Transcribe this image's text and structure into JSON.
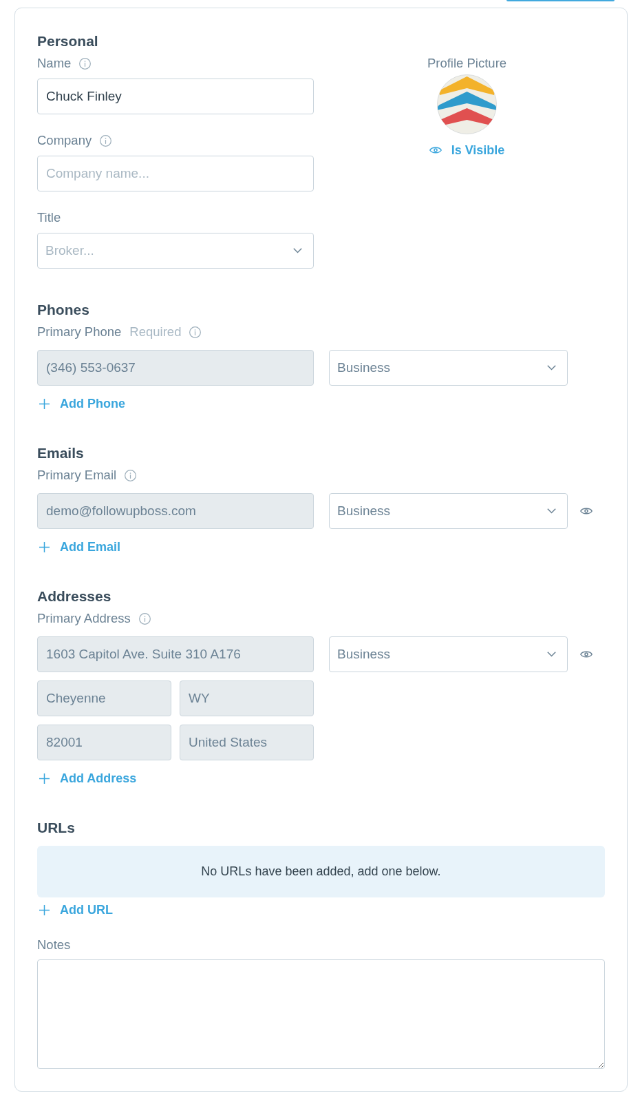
{
  "personal": {
    "heading": "Personal",
    "fields": [
      {
        "kind": "text",
        "label": "Name",
        "info": true,
        "value": "Chuck Finley",
        "disabled": false
      },
      {
        "kind": "text",
        "label": "Company",
        "info": true,
        "placeholder": "Company name...",
        "disabled": false
      },
      {
        "kind": "select",
        "label": "Title",
        "info": false,
        "placeholder": "Broker..."
      }
    ],
    "profile_picture": {
      "label": "Profile Picture",
      "visible": true,
      "visibility_label": "Is Visible"
    }
  },
  "contact_sections": [
    {
      "heading": "Phones",
      "label": "Primary Phone",
      "hint": "Required",
      "info": true,
      "rows": [
        [
          {
            "value": "(346) 553-0637",
            "disabled": true
          }
        ]
      ],
      "type": "Business",
      "visibility_toggle": false,
      "add_label": "Add Phone"
    },
    {
      "heading": "Emails",
      "label": "Primary Email",
      "info": true,
      "rows": [
        [
          {
            "value": "demo@followupboss.com",
            "disabled": true
          }
        ]
      ],
      "type": "Business",
      "visibility_toggle": true,
      "add_label": "Add Email"
    },
    {
      "heading": "Addresses",
      "label": "Primary Address",
      "info": true,
      "rows": [
        [
          {
            "value": "1603 Capitol Ave. Suite 310 A176",
            "disabled": true
          }
        ],
        [
          {
            "value": "Cheyenne",
            "disabled": true
          },
          {
            "value": "WY",
            "disabled": true
          }
        ],
        [
          {
            "value": "82001",
            "disabled": true
          },
          {
            "value": "United States",
            "disabled": true
          }
        ]
      ],
      "type": "Business",
      "visibility_toggle": true,
      "add_label": "Add Address"
    }
  ],
  "urls": {
    "heading": "URLs",
    "empty_message": "No URLs have been added, add one below.",
    "add_label": "Add URL"
  },
  "notes": {
    "label": "Notes"
  }
}
